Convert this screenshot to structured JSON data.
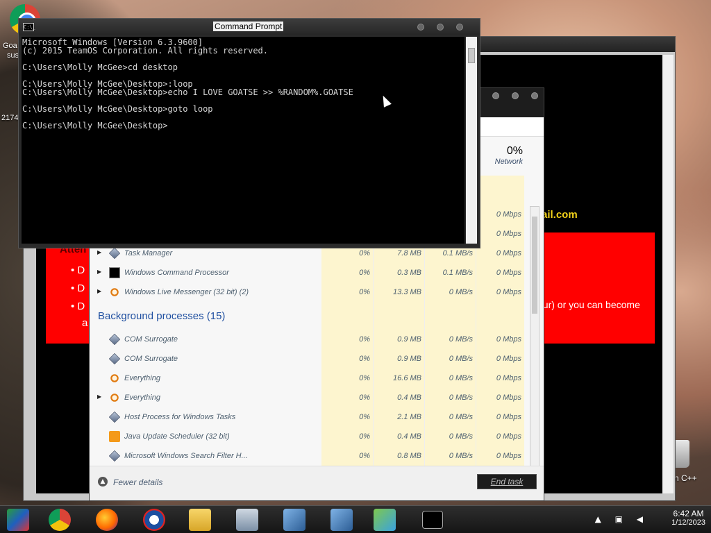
{
  "desktop": {
    "icon_label_1": "Goa",
    "icon_label_2": "sus",
    "icon_label_3": "2174",
    "recycle_label": "n C++"
  },
  "back_window": {
    "email_fragment": "ail.com",
    "heading_fragment": "Atten",
    "bullet_1": "D",
    "bullet_2": "D",
    "bullet_3": "D",
    "line_4_fragment": "a",
    "trailing_text": "our) or you can become"
  },
  "task_manager": {
    "network_header": {
      "percent": "0%",
      "label": "Network"
    },
    "apps": [
      {
        "name": "Task Manager",
        "cpu": "0%",
        "mem": "7.8 MB",
        "disk": "0.1 MB/s",
        "net": "0 Mbps",
        "icon": "task-manager-icon",
        "expander": true
      },
      {
        "name": "Windows Command Processor",
        "cpu": "0%",
        "mem": "0.3 MB",
        "disk": "0.1 MB/s",
        "net": "0 Mbps",
        "icon": "cmd-icon",
        "expander": true
      },
      {
        "name": "Windows Live Messenger (32 bit) (2)",
        "cpu": "0%",
        "mem": "13.3 MB",
        "disk": "0 MB/s",
        "net": "0 Mbps",
        "icon": "messenger-icon",
        "expander": true
      }
    ],
    "background_title": "Background processes (15)",
    "background": [
      {
        "name": "COM Surrogate",
        "cpu": "0%",
        "mem": "0.9 MB",
        "disk": "0 MB/s",
        "net": "0 Mbps",
        "icon": "com-surrogate-icon",
        "expander": false
      },
      {
        "name": "COM Surrogate",
        "cpu": "0%",
        "mem": "0.9 MB",
        "disk": "0 MB/s",
        "net": "0 Mbps",
        "icon": "com-surrogate-icon",
        "expander": false
      },
      {
        "name": "Everything",
        "cpu": "0%",
        "mem": "16.6 MB",
        "disk": "0 MB/s",
        "net": "0 Mbps",
        "icon": "everything-icon",
        "expander": false
      },
      {
        "name": "Everything",
        "cpu": "0%",
        "mem": "0.4 MB",
        "disk": "0 MB/s",
        "net": "0 Mbps",
        "icon": "everything-icon",
        "expander": true
      },
      {
        "name": "Host Process for Windows Tasks",
        "cpu": "0%",
        "mem": "2.1 MB",
        "disk": "0 MB/s",
        "net": "0 Mbps",
        "icon": "host-process-icon",
        "expander": false
      },
      {
        "name": "Java Update Scheduler (32 bit)",
        "cpu": "0%",
        "mem": "0.4 MB",
        "disk": "0 MB/s",
        "net": "0 Mbps",
        "icon": "java-icon",
        "expander": false
      },
      {
        "name": "Microsoft Windows Search Filter H...",
        "cpu": "0%",
        "mem": "0.8 MB",
        "disk": "0 MB/s",
        "net": "0 Mbps",
        "icon": "search-filter-icon",
        "expander": false
      }
    ],
    "upper_rows_net": [
      "0 Mbps",
      "0 Mbps"
    ],
    "fewer_details": "Fewer details",
    "end_task": "End task"
  },
  "cmd": {
    "title": "Command Prompt",
    "icon_text": "C:\\_",
    "lines": [
      "Microsoft Windows [Version 6.3.9600]",
      "(c) 2015 TeamOS Corporation. All rights reserved.",
      "",
      "C:\\Users\\Molly McGee>cd desktop",
      "",
      "C:\\Users\\Molly McGee\\Desktop>:loop",
      "C:\\Users\\Molly McGee\\Desktop>echo I LOVE GOATSE >> %RANDOM%.GOATSE",
      "",
      "C:\\Users\\Molly McGee\\Desktop>goto loop",
      "",
      "C:\\Users\\Molly McGee\\Desktop>"
    ]
  },
  "taskbar": {
    "items": [
      "media-center-icon",
      "chrome-icon",
      "firefox-icon",
      "obama-logo-icon",
      "file-explorer-icon",
      "performance-monitor-icon",
      "remote-desktop-icon",
      "remote-desktop-icon",
      "messenger-icon",
      "cmd-icon"
    ],
    "time": "6:42 AM",
    "date": "1/12/2023"
  }
}
